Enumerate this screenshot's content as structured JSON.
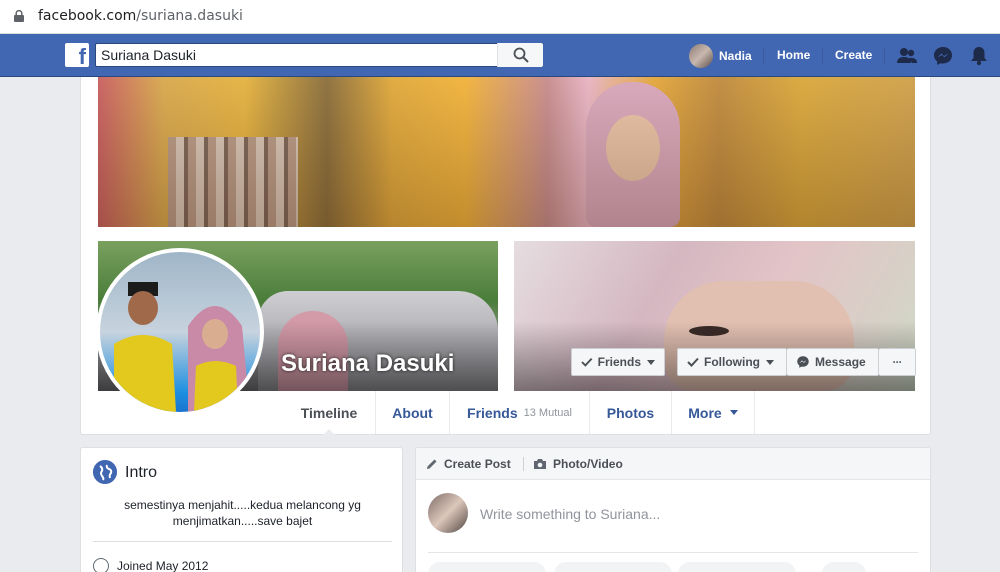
{
  "browser": {
    "url_host": "facebook.com",
    "url_path": "/suriana.dasuki"
  },
  "topbar": {
    "search_value": "Suriana Dasuki",
    "user_name": "Nadia",
    "home_label": "Home",
    "create_label": "Create",
    "brand_color": "#4267b2"
  },
  "profile": {
    "name": "Suriana Dasuki",
    "friends_button": "Friends",
    "following_button": "Following",
    "message_button": "Message",
    "more_button": "···"
  },
  "tabs": [
    {
      "label": "Timeline",
      "active": true
    },
    {
      "label": "About"
    },
    {
      "label": "Friends",
      "badge": "13 Mutual"
    },
    {
      "label": "Photos"
    },
    {
      "label": "More"
    }
  ],
  "intro": {
    "title": "Intro",
    "bio": "semestinya menjahit.....kedua melancong yg menjimatkan.....save bajet",
    "joined": "Joined May 2012"
  },
  "composer": {
    "create_post": "Create Post",
    "photo_video": "Photo/Video",
    "placeholder": "Write something to Suriana..."
  }
}
